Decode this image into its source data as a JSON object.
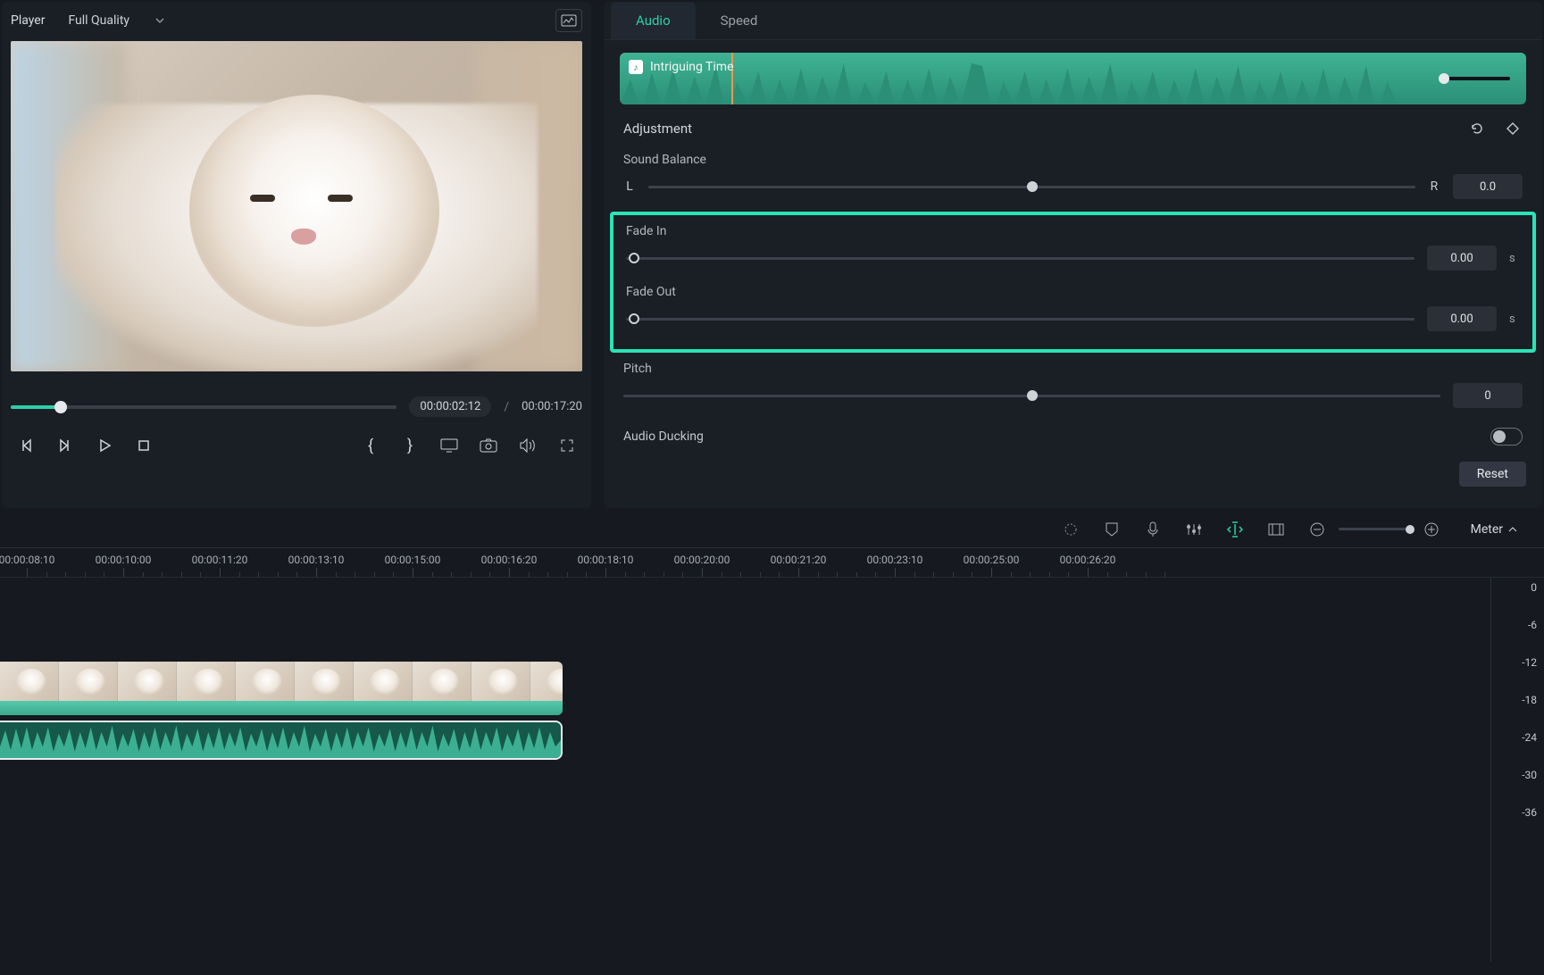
{
  "player": {
    "title": "Player",
    "quality": "Full Quality",
    "current_time": "00:00:02:12",
    "duration": "00:00:17:20"
  },
  "tabs": {
    "audio": "Audio",
    "speed": "Speed"
  },
  "audio_track": {
    "name": "Intriguing Time"
  },
  "sections": {
    "adjustment": "Adjustment",
    "sound_balance": {
      "label": "Sound Balance",
      "left": "L",
      "right": "R",
      "value": "0.0"
    },
    "fade_in": {
      "label": "Fade In",
      "value": "0.00",
      "unit": "s"
    },
    "fade_out": {
      "label": "Fade Out",
      "value": "0.00",
      "unit": "s"
    },
    "pitch": {
      "label": "Pitch",
      "value": "0"
    },
    "ducking": {
      "label": "Audio Ducking"
    },
    "reset": "Reset"
  },
  "toolbar": {
    "meter": "Meter"
  },
  "ruler": [
    "00:00:08:10",
    "00:00:10:00",
    "00:00:11:20",
    "00:00:13:10",
    "00:00:15:00",
    "00:00:16:20",
    "00:00:18:10",
    "00:00:20:00",
    "00:00:21:20",
    "00:00:23:10",
    "00:00:25:00",
    "00:00:26:20"
  ],
  "meter_ticks": [
    "0",
    "-6",
    "-12",
    "-18",
    "-24",
    "-30",
    "-36"
  ]
}
